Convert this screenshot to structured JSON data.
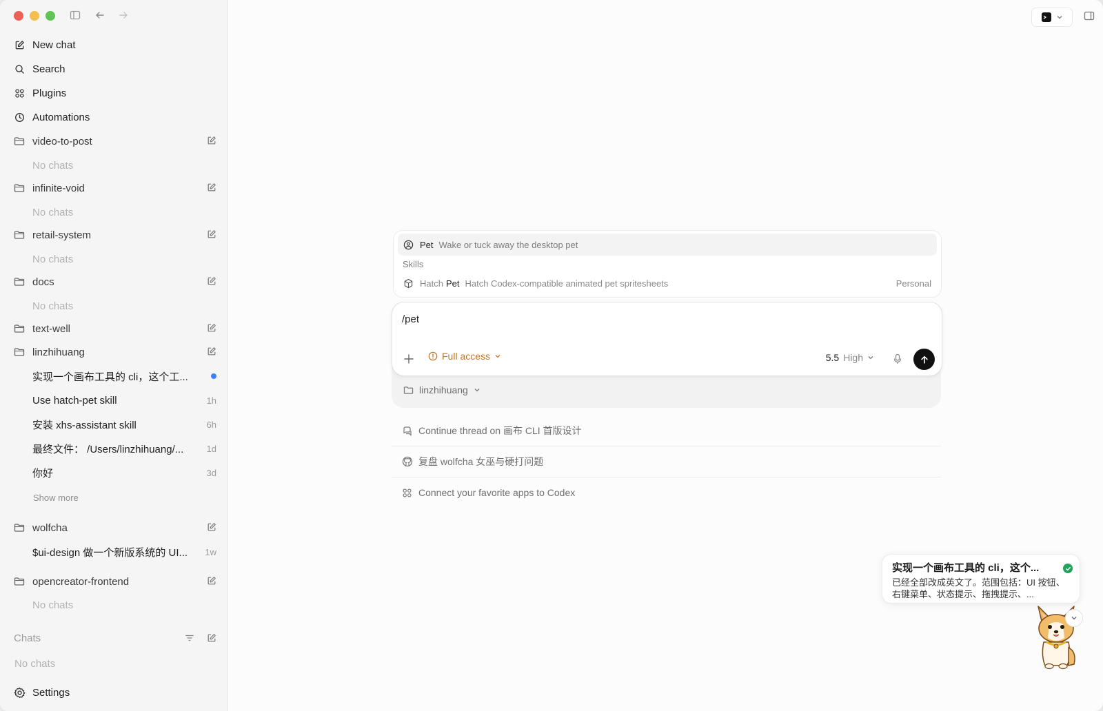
{
  "sidebar": {
    "nav": [
      {
        "label": "New chat",
        "icon": "compose-icon"
      },
      {
        "label": "Search",
        "icon": "search-icon"
      },
      {
        "label": "Plugins",
        "icon": "grid-icon"
      },
      {
        "label": "Automations",
        "icon": "clock-icon"
      }
    ],
    "projects": [
      {
        "name": "video-to-post",
        "empty": "No chats"
      },
      {
        "name": "infinite-void",
        "empty": "No chats"
      },
      {
        "name": "retail-system",
        "empty": "No chats"
      },
      {
        "name": "docs",
        "empty": "No chats"
      },
      {
        "name": "text-well"
      },
      {
        "name": "linzhihuang"
      },
      {
        "name": "wolfcha"
      },
      {
        "name": "opencreator-frontend",
        "empty": "No chats"
      }
    ],
    "linzhihuang_chats": [
      {
        "title": "实现一个画布工具的 cli，这个工...",
        "time": ""
      },
      {
        "title": "Use hatch-pet skill",
        "time": "1h"
      },
      {
        "title": "安装 xhs-assistant skill",
        "time": "6h"
      },
      {
        "title": "最终文件： /Users/linzhihuang/...",
        "time": "1d"
      },
      {
        "title": "你好",
        "time": "3d"
      }
    ],
    "show_more": "Show more",
    "wolfcha_chats": [
      {
        "title": "$ui-design 做一个新版系统的 UI...",
        "time": "1w"
      }
    ],
    "chats_header": "Chats",
    "chats_empty": "No chats",
    "settings": "Settings"
  },
  "suggest": {
    "top": {
      "name": "Pet",
      "desc": "Wake or tuck away the desktop pet"
    },
    "section": "Skills",
    "skill": {
      "prefix": "Hatch",
      "name": "Pet",
      "desc": "Hatch Codex-compatible animated pet spritesheets",
      "tag": "Personal"
    }
  },
  "composer": {
    "input": "/pet",
    "access": "Full access",
    "model": "5.5",
    "effort": "High",
    "folder": "linzhihuang"
  },
  "suggestions": [
    {
      "text": "Continue thread on 画布 CLI 首版设计",
      "icon": "thread-icon"
    },
    {
      "text": "复盘 wolfcha 女巫与硬打问题",
      "icon": "github-icon"
    },
    {
      "text": "Connect your favorite apps to Codex",
      "icon": "apps-icon"
    }
  ],
  "notification": {
    "title": "实现一个画布工具的 cli，这个...",
    "body": "已经全部改成英文了。范围包括：UI 按钮、右键菜单、状态提示、拖拽提示、..."
  },
  "colors": {
    "accent_orange": "#c8741f",
    "unread_blue": "#3a82f7",
    "success_green": "#22a55b"
  }
}
